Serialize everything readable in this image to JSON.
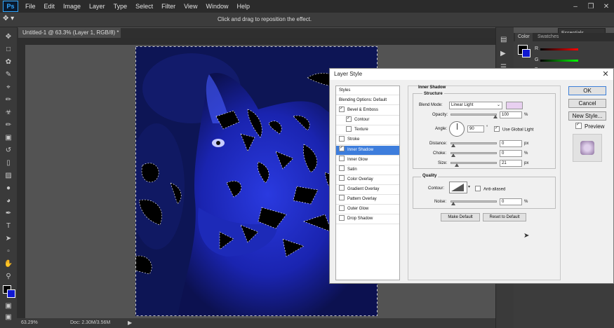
{
  "app": {
    "logo": "Ps"
  },
  "menu": [
    "File",
    "Edit",
    "Image",
    "Layer",
    "Type",
    "Select",
    "Filter",
    "View",
    "Window",
    "Help"
  ],
  "options_bar": {
    "message": "Click and drag to reposition the effect.",
    "workspace": "Essentials"
  },
  "document": {
    "tab_title": "Untitled-1 @ 63.3% (Layer 1, RGB/8) *",
    "tab_close": "×"
  },
  "status": {
    "zoom": "63.29%",
    "doc_info": "Doc: 2.30M/3.56M"
  },
  "panels": {
    "tabs": [
      "Color",
      "Swatches"
    ],
    "channels": [
      "R",
      "G",
      "B"
    ]
  },
  "dialog": {
    "title": "Layer Style",
    "close": "✕",
    "styles_header": "Styles",
    "style_items": [
      {
        "label": "Blending Options: Default",
        "checkbox": false,
        "checked": false,
        "indent": false,
        "selected": false
      },
      {
        "label": "Bevel & Emboss",
        "checkbox": true,
        "checked": true,
        "indent": false,
        "selected": false
      },
      {
        "label": "Contour",
        "checkbox": true,
        "checked": true,
        "indent": true,
        "selected": false
      },
      {
        "label": "Texture",
        "checkbox": true,
        "checked": false,
        "indent": true,
        "selected": false
      },
      {
        "label": "Stroke",
        "checkbox": true,
        "checked": false,
        "indent": false,
        "selected": false
      },
      {
        "label": "Inner Shadow",
        "checkbox": true,
        "checked": true,
        "indent": false,
        "selected": true
      },
      {
        "label": "Inner Glow",
        "checkbox": true,
        "checked": false,
        "indent": false,
        "selected": false
      },
      {
        "label": "Satin",
        "checkbox": true,
        "checked": false,
        "indent": false,
        "selected": false
      },
      {
        "label": "Color Overlay",
        "checkbox": true,
        "checked": false,
        "indent": false,
        "selected": false
      },
      {
        "label": "Gradient Overlay",
        "checkbox": true,
        "checked": false,
        "indent": false,
        "selected": false
      },
      {
        "label": "Pattern Overlay",
        "checkbox": true,
        "checked": false,
        "indent": false,
        "selected": false
      },
      {
        "label": "Outer Glow",
        "checkbox": true,
        "checked": false,
        "indent": false,
        "selected": false
      },
      {
        "label": "Drop Shadow",
        "checkbox": true,
        "checked": false,
        "indent": false,
        "selected": false
      }
    ],
    "section_title": "Inner Shadow",
    "structure": {
      "title": "Structure",
      "blend_mode_label": "Blend Mode:",
      "blend_mode_value": "Linear Light",
      "blend_color": "#e8d0f0",
      "opacity_label": "Opacity:",
      "opacity_value": "100",
      "opacity_unit": "%",
      "opacity_fraction": 1.0,
      "angle_label": "Angle:",
      "angle_value": "90",
      "angle_unit": "°",
      "global_light_label": "Use Global Light",
      "global_light_checked": true,
      "distance_label": "Distance:",
      "distance_value": "0",
      "distance_unit": "px",
      "distance_fraction": 0.0,
      "choke_label": "Choke:",
      "choke_value": "0",
      "choke_unit": "%",
      "choke_fraction": 0.0,
      "size_label": "Size:",
      "size_value": "21",
      "size_unit": "px",
      "size_fraction": 0.09
    },
    "quality": {
      "title": "Quality",
      "contour_label": "Contour:",
      "anti_aliased_label": "Anti-aliased",
      "anti_aliased_checked": false,
      "noise_label": "Noise:",
      "noise_value": "0",
      "noise_unit": "%",
      "noise_fraction": 0.0
    },
    "make_default": "Make Default",
    "reset_default": "Reset to Default",
    "ok": "OK",
    "cancel": "Cancel",
    "new_style": "New Style...",
    "preview_label": "Preview",
    "preview_checked": true
  },
  "colors": {
    "canvas_blue": "#1c2ac8",
    "selection": "#2f6fd6"
  }
}
